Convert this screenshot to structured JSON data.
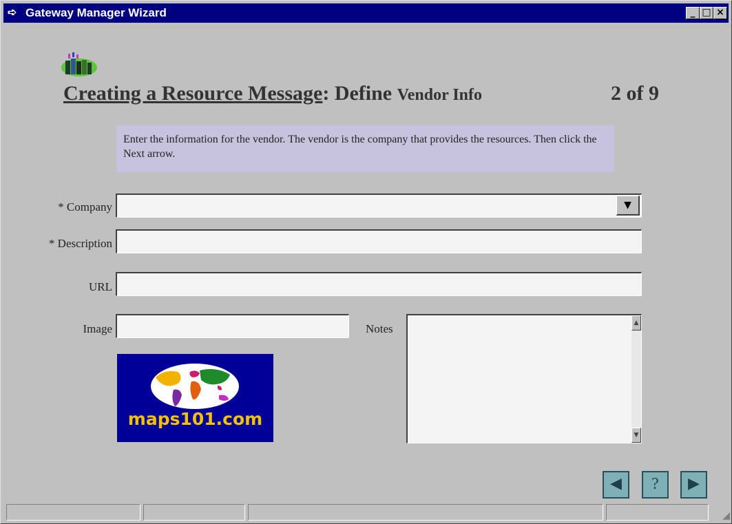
{
  "window": {
    "title": "Gateway Manager Wizard",
    "title_icon": "wizard-arrow-icon",
    "controls": {
      "minimize": "_",
      "maximize": "□",
      "close": "×"
    }
  },
  "header": {
    "title_main": "Creating a Resource Message",
    "title_colon": ": ",
    "title_define": "Define ",
    "title_sub": "Vendor Info",
    "page_indicator": "2 of 9",
    "logo_icon": "gateway-books-icon"
  },
  "instructions": "Enter the information for the vendor. The vendor is the company that provides the resources. Then click the Next arrow.",
  "form": {
    "company_label": "* Company",
    "company_value": "",
    "description_label": "* Description",
    "description_value": "",
    "url_label": "URL",
    "url_value": "",
    "image_label": "Image",
    "image_value": "",
    "notes_label": "Notes",
    "notes_value": ""
  },
  "image_preview": {
    "text": "maps101.com",
    "icon": "world-map-icon"
  },
  "nav": {
    "back_icon": "back-arrow-icon",
    "help_label": "?",
    "next_icon": "next-arrow-icon"
  },
  "colors": {
    "titlebar": "#000080",
    "window": "#c0c0c0",
    "instructions_bg": "#c7c3de",
    "nav_button": "#7fb0b8",
    "map_logo_bg": "#000099",
    "map_logo_text": "#f2c200"
  }
}
